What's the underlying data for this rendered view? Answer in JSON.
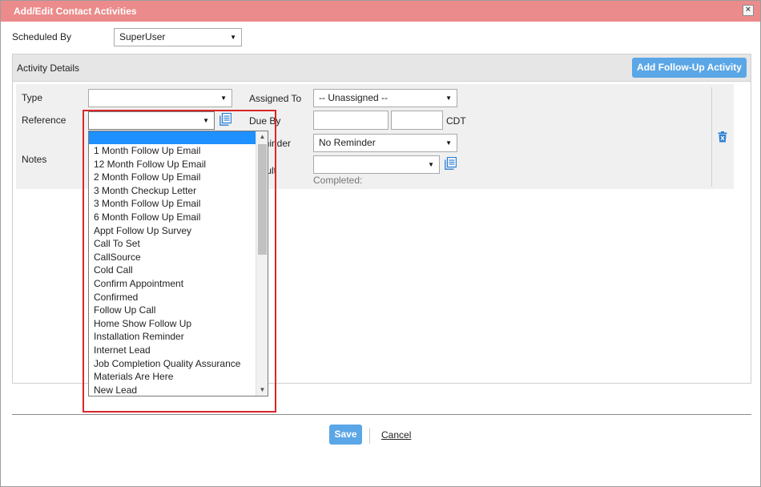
{
  "window": {
    "title": "Add/Edit Contact Activities",
    "close_glyph": "×"
  },
  "scheduled_by": {
    "label": "Scheduled By",
    "value": "SuperUser"
  },
  "activity_details": {
    "heading": "Activity Details",
    "add_button": "Add Follow-Up Activity",
    "type_label": "Type",
    "type_value": "",
    "reference_label": "Reference",
    "reference_value": "",
    "notes_label": "Notes",
    "assigned_to_label": "Assigned To",
    "assigned_to_value": "-- Unassigned --",
    "due_by_label": "Due By",
    "due_date_value": "",
    "due_time_value": "",
    "timezone": "CDT",
    "reminder_label": "Reminder",
    "reminder_value": "No Reminder",
    "result_label": "Result",
    "result_value": "",
    "completed_label": "Completed:"
  },
  "reference_dropdown": {
    "options": [
      "",
      "1 Month Follow Up Email",
      "12 Month Follow Up Email",
      "2 Month Follow Up Email",
      "3 Month Checkup Letter",
      "3 Month Follow Up Email",
      "6 Month Follow Up Email",
      "Appt Follow Up Survey",
      "Call To Set",
      "CallSource",
      "Cold Call",
      "Confirm Appointment",
      "Confirmed",
      "Follow Up Call",
      "Home Show Follow Up",
      "Installation Reminder",
      "Internet Lead",
      "Job Completion Quality Assurance",
      "Materials Are Here",
      "New Lead"
    ],
    "selected_index": 0
  },
  "footer": {
    "save_label": "Save",
    "cancel_label": "Cancel"
  },
  "colors": {
    "titlebar": "#ec8b8b",
    "button_blue": "#5aa6e6",
    "highlight_red": "#d9262b",
    "selected_blue": "#1e90ff"
  },
  "icons": {
    "close": "close-icon",
    "notes_lookup": "document-list-icon",
    "delete": "trash-icon"
  }
}
